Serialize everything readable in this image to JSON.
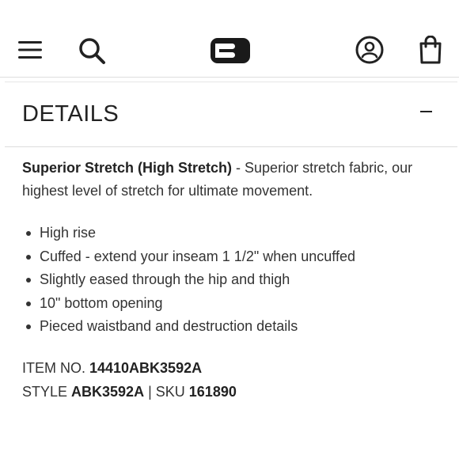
{
  "header": {
    "menu_icon": "hamburger-menu-icon",
    "search_icon": "search-icon",
    "logo_icon": "brand-logo-icon",
    "account_icon": "account-icon",
    "bag_icon": "shopping-bag-icon"
  },
  "details": {
    "title": "DETAILS",
    "collapse_icon": "minus-icon",
    "fabric_name": "Superior Stretch (High Stretch)",
    "fabric_desc": " - Superior stretch fabric, our highest level of stretch for ultimate movement.",
    "features": [
      "High rise",
      "Cuffed - extend your inseam 1 1/2\" when uncuffed",
      "Slightly eased through the hip and thigh",
      "10\" bottom opening",
      "Pieced waistband and destruction details"
    ],
    "item_no_label": "ITEM NO. ",
    "item_no": "14410ABK3592A",
    "style_label": "STYLE ",
    "style": "ABK3592A",
    "sep": " | ",
    "sku_label": "SKU ",
    "sku": "161890"
  },
  "colors": {
    "text": "#222222",
    "divider": "#dcdcdc"
  }
}
